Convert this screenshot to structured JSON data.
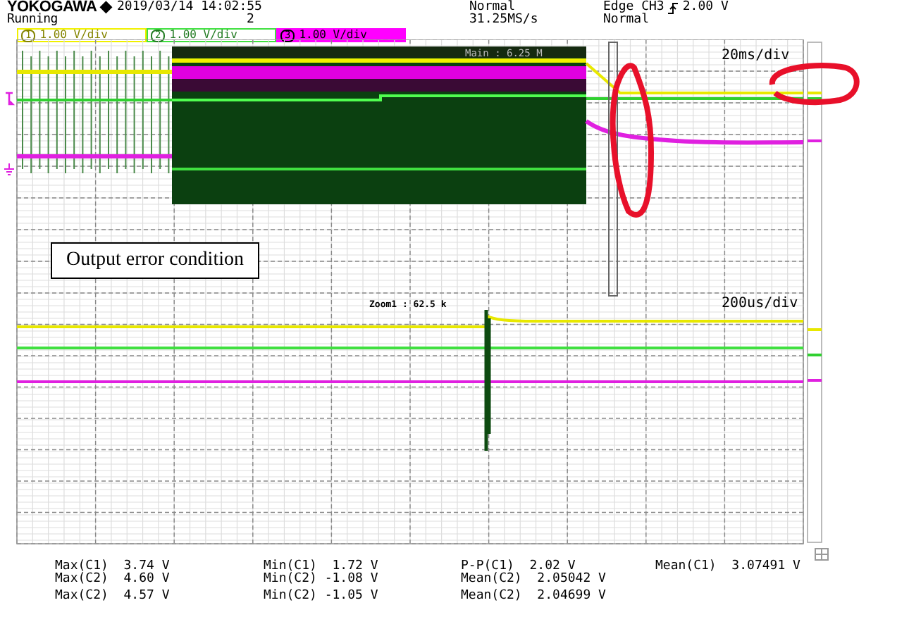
{
  "header": {
    "brand": "YOKOGAWA ◆",
    "datetime": "2019/03/14 14:02:55",
    "state": "Running",
    "display": "2",
    "acq_mode": "Normal",
    "sample_rate": "31.25MS/s",
    "trigger_source": "Edge CH3",
    "trigger_level": "2.00 V",
    "trigger_mode": "Normal"
  },
  "channels": [
    {
      "number": "1",
      "label": "1.00 V/div",
      "color": "#f0f000",
      "selected": false
    },
    {
      "number": "2",
      "label": "1.00 V/div",
      "color": "#40e040",
      "selected": false
    },
    {
      "number": "3",
      "label": "1.00 V/div",
      "color": "#ff00ff",
      "selected": true
    }
  ],
  "main_window": {
    "info": "Main : 6.25 M",
    "timebase": "20ms/div"
  },
  "zoom_window": {
    "info": "Zoom1 : 62.5 k",
    "timebase": "200us/div"
  },
  "annotation": "Output error condition",
  "measurements": [
    [
      "Max(C1)  3.74 V",
      "Min(C1)  1.72 V",
      "P-P(C1)  2.02 V",
      "Mean(C1)  3.07491 V"
    ],
    [
      "Max(C2)  4.60 V",
      "Min(C2) -1.08 V",
      "Mean(C2)  2.05042 V"
    ],
    [
      "Max(C2)  4.57 V",
      "Min(C2) -1.05 V",
      "Mean(C2)  2.04699 V"
    ]
  ]
}
